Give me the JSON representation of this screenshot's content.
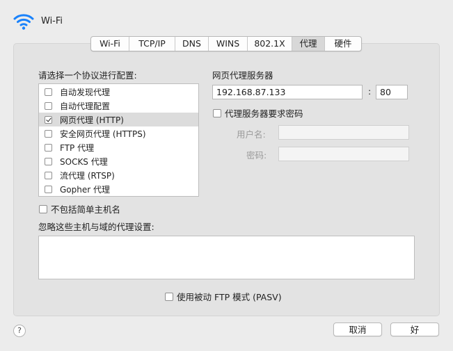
{
  "header": {
    "title": "Wi-Fi",
    "icon": "wifi-icon",
    "icon_color": "#1a82fb"
  },
  "tabs": [
    {
      "label": "Wi-Fi"
    },
    {
      "label": "TCP/IP"
    },
    {
      "label": "DNS"
    },
    {
      "label": "WINS"
    },
    {
      "label": "802.1X"
    },
    {
      "label": "代理",
      "active": true
    },
    {
      "label": "硬件"
    }
  ],
  "protocols": {
    "heading": "请选择一个协议进行配置:",
    "items": [
      {
        "label": "自动发现代理",
        "checked": false
      },
      {
        "label": "自动代理配置",
        "checked": false
      },
      {
        "label": "网页代理 (HTTP)",
        "checked": true,
        "selected": true
      },
      {
        "label": "安全网页代理 (HTTPS)",
        "checked": false
      },
      {
        "label": "FTP 代理",
        "checked": false
      },
      {
        "label": "SOCKS 代理",
        "checked": false
      },
      {
        "label": "流代理 (RTSP)",
        "checked": false
      },
      {
        "label": "Gopher 代理",
        "checked": false
      }
    ]
  },
  "server": {
    "heading": "网页代理服务器",
    "address": "192.168.87.133",
    "separator": ":",
    "port": "80",
    "password_required_label": "代理服务器要求密码",
    "password_required": false,
    "username_label": "用户名:",
    "username": "",
    "password_label": "密码:",
    "password": ""
  },
  "exclude_simple_hostnames_label": "不包括简单主机名",
  "bypass": {
    "heading": "忽略这些主机与域的代理设置:",
    "value": ""
  },
  "passive_ftp_label": "使用被动 FTP 模式 (PASV)",
  "footer": {
    "help_label": "?",
    "cancel_label": "取消",
    "ok_label": "好"
  }
}
